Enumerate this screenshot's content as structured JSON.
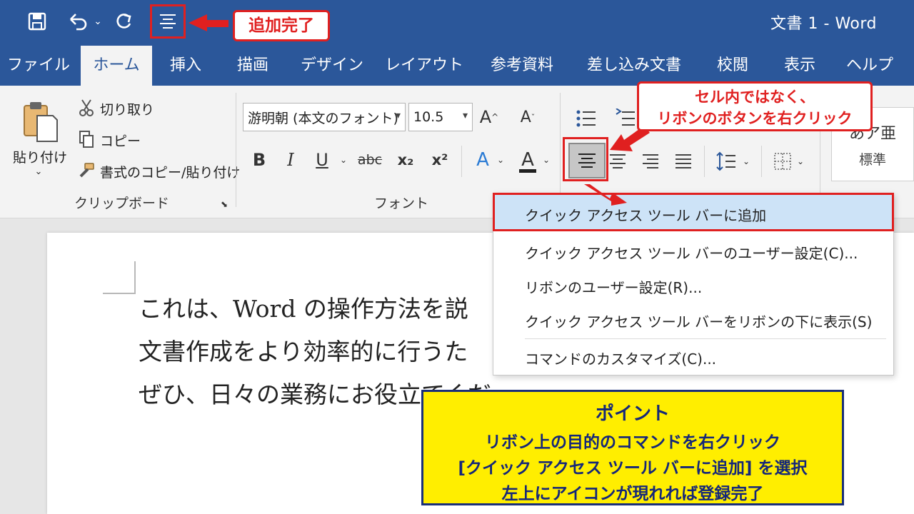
{
  "titlebar": {
    "title": "文書 1 - Word",
    "qat_save_icon": "save-icon",
    "qat_undo_icon": "undo-icon",
    "qat_redo_icon": "redo-icon",
    "qat_added_icon": "align-center-icon"
  },
  "tabs": [
    "ファイル",
    "ホーム",
    "挿入",
    "描画",
    "デザイン",
    "レイアウト",
    "参考資料",
    "差し込み文書",
    "校閲",
    "表示",
    "ヘルプ"
  ],
  "active_tab": "ホーム",
  "clipboard": {
    "paste": "貼り付け",
    "cut": "切り取り",
    "copy": "コピー",
    "format_painter": "書式のコピー/貼り付け",
    "group_label": "クリップボード"
  },
  "font": {
    "font_name": "游明朝 (本文のフォント)",
    "font_size": "10.5",
    "group_label": "フォント",
    "bold": "B",
    "italic": "I",
    "underline": "U",
    "strike": "abc",
    "subscript": "x₂",
    "superscript": "x²"
  },
  "styles": {
    "preview": "あア亜",
    "name": "標準"
  },
  "context_menu": {
    "items": [
      "クイック アクセス ツール バーに追加",
      "クイック アクセス ツール バーのユーザー設定(C)...",
      "リボンのユーザー設定(R)...",
      "クイック アクセス ツール バーをリボンの下に表示(S)",
      "コマンドのカスタマイズ(C)..."
    ]
  },
  "document": {
    "lines": [
      "これは、Word の操作方法を説",
      "文書作成をより効率的に行うた",
      "ぜひ、日々の業務にお役立てくだ"
    ]
  },
  "callouts": {
    "added": "追加完了",
    "right_click_line1": "セル内ではなく、",
    "right_click_line2": "リボンのボタンを右クリック"
  },
  "point": {
    "title": "ポイント",
    "line1": "リボン上の目的のコマンドを右クリック",
    "line2": "[クイック アクセス ツール バーに追加] を選択",
    "line3": "左上にアイコンが現れれば登録完了"
  },
  "colors": {
    "word_blue": "#2b579a",
    "highlight_red": "#e02020",
    "point_yellow": "#ffee00"
  }
}
